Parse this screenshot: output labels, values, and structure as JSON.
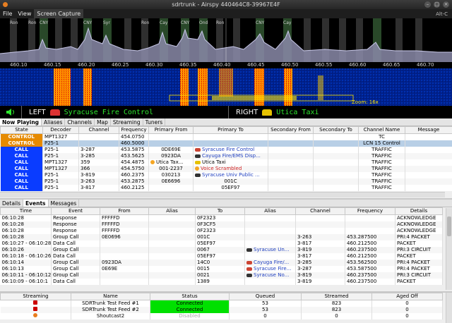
{
  "window": {
    "title": "sdrtrunk - Airspy 440464C8-39967E4F"
  },
  "menu": {
    "items": [
      "File",
      "View",
      "Screen Capture"
    ],
    "shortcut": "Alt-C"
  },
  "spectrum": {
    "labels": [
      {
        "text": "Ron"
      },
      {
        "text": "Ron"
      },
      {
        "text": "Ron"
      },
      {
        "text": "Ron"
      },
      {
        "text": "CNY"
      },
      {
        "text": "CNY"
      },
      {
        "text": "CNY"
      },
      {
        "text": "CNY"
      },
      {
        "text": "Syr"
      },
      {
        "text": "Cay"
      },
      {
        "text": "Ond"
      },
      {
        "text": "Cay"
      }
    ]
  },
  "axis": {
    "ticks": [
      "460.10",
      "460.15",
      "460.20",
      "460.25",
      "460.30",
      "460.35",
      "460.40",
      "460.45",
      "460.50",
      "460.55",
      "460.60",
      "460.65",
      "460.70"
    ]
  },
  "waterfall": {
    "zoom_label": "Zoom: 16x"
  },
  "audio": {
    "left_label": "LEFT",
    "left_channel": "Syracuse Fire Control",
    "right_label": "RIGHT",
    "right_channel": "Utica Taxi"
  },
  "top_tabs": [
    "Now Playing",
    "Aliases",
    "Channels",
    "Map",
    "Streaming",
    "Tuners"
  ],
  "channels_table": {
    "headers": [
      "State",
      "Decoder",
      "Channel",
      "Frequency",
      "Primary From",
      "Primary To",
      "Secondary From",
      "Secondary To",
      "Channel Name",
      "Message"
    ],
    "rows": [
      {
        "state": "CONTROL",
        "decoder": "MPT1327",
        "channel": "",
        "freq": "454.0750",
        "pfrom": "",
        "pto": "",
        "sfrom": "",
        "sto": "",
        "name": "TC",
        "msg": ""
      },
      {
        "state": "CONTROL",
        "decoder": "P25-1",
        "channel": "",
        "freq": "460.5000",
        "pfrom": "",
        "pto": "",
        "sfrom": "",
        "sto": "",
        "name": "LCN 15 Control",
        "msg": ""
      },
      {
        "state": "CALL",
        "decoder": "P25-1",
        "channel": "3-287",
        "freq": "453.5875",
        "pfrom": "0DE69E",
        "pto": "Syracuse Fire Control",
        "sfrom": "",
        "sto": "",
        "name": "TRAFFIC",
        "msg": ""
      },
      {
        "state": "CALL",
        "decoder": "P25-1",
        "channel": "3-285",
        "freq": "453.5625",
        "pfrom": "0923DA",
        "pto": "Cayuga Fire/EMS Disp...",
        "sfrom": "",
        "sto": "",
        "name": "TRAFFIC",
        "msg": ""
      },
      {
        "state": "CALL",
        "decoder": "MPT1327",
        "channel": "359",
        "freq": "454.4875",
        "pfrom": "Utica Tax...",
        "pto": "Utica Taxi",
        "sfrom": "",
        "sto": "",
        "name": "TRAFFIC",
        "msg": ""
      },
      {
        "state": "CALL",
        "decoder": "MPT1327",
        "channel": "366",
        "freq": "454.5750",
        "pfrom": "001-2237",
        "pto": "Voice Scrambled",
        "sfrom": "",
        "sto": "",
        "name": "TRAFFIC",
        "msg": ""
      },
      {
        "state": "CALL",
        "decoder": "P25-1",
        "channel": "3-819",
        "freq": "460.2375",
        "pfrom": "030213",
        "pto": "Syracuse Univ Public ...",
        "sfrom": "",
        "sto": "",
        "name": "TRAFFIC",
        "msg": ""
      },
      {
        "state": "CALL",
        "decoder": "P25-1",
        "channel": "3-263",
        "freq": "453.2875",
        "pfrom": "0E6696",
        "pto": "001C",
        "sfrom": "",
        "sto": "",
        "name": "TRAFFIC",
        "msg": ""
      },
      {
        "state": "CALL",
        "decoder": "P25-1",
        "channel": "3-817",
        "freq": "460.2125",
        "pfrom": "",
        "pto": "05EF97",
        "sfrom": "",
        "sto": "",
        "name": "TRAFFIC",
        "msg": ""
      }
    ]
  },
  "bottom_tabs": [
    "Details",
    "Events",
    "Messages"
  ],
  "events_table": {
    "headers": [
      "Time",
      "Event",
      "From",
      "Alias",
      "To",
      "Alias",
      "Channel",
      "Frequency",
      "Details"
    ],
    "rows": [
      {
        "time": "06:10:28",
        "event": "Response",
        "from": "FFFFFD",
        "falias": "",
        "to": "0F2323",
        "talias": "",
        "ch": "",
        "freq": "",
        "details": "ACKNOWLEDGE"
      },
      {
        "time": "06:10:28",
        "event": "Response",
        "from": "FFFFFD",
        "falias": "",
        "to": "0F3CF5",
        "talias": "",
        "ch": "",
        "freq": "",
        "details": "ACKNOWLEDGE"
      },
      {
        "time": "06:10:28",
        "event": "Response",
        "from": "FFFFFD",
        "falias": "",
        "to": "0F2323",
        "talias": "",
        "ch": "",
        "freq": "",
        "details": "ACKNOWLEDGE"
      },
      {
        "time": "06:10:28",
        "event": "Group Call",
        "from": "0E0696",
        "falias": "",
        "to": "001C",
        "talias": "",
        "ch": "3-263",
        "freq": "453.287500",
        "details": "PRI:4 PACKET"
      },
      {
        "time": "06:10:27 - 06:10:28",
        "event": "Data Call",
        "from": "",
        "falias": "",
        "to": "05EF97",
        "talias": "",
        "ch": "3-817",
        "freq": "460.212500",
        "details": "PACKET"
      },
      {
        "time": "06:10:26",
        "event": "Group Call",
        "from": "",
        "falias": "",
        "to": "0067",
        "talias": "Syracuse Un...",
        "ch": "3-819",
        "freq": "460.237500",
        "details": "PRI:3 CIRCUIT"
      },
      {
        "time": "06:10:18 - 06:10:26",
        "event": "Data Call",
        "from": "",
        "falias": "",
        "to": "05EF97",
        "talias": "",
        "ch": "3-817",
        "freq": "460.212500",
        "details": "PACKET"
      },
      {
        "time": "06:10:14",
        "event": "Group Call",
        "from": "0923DA",
        "falias": "",
        "to": "14C0",
        "talias": "Cayuga Fire/...",
        "ch": "3-285",
        "freq": "453.562500",
        "details": "PRI:4 PACKET"
      },
      {
        "time": "06:10:13",
        "event": "Group Call",
        "from": "0E69E",
        "falias": "",
        "to": "0015",
        "talias": "Syracuse Fire...",
        "ch": "3-287",
        "freq": "453.587500",
        "details": "PRI:4 PACKET"
      },
      {
        "time": "06:10:11 - 06:10:12",
        "event": "Group Call",
        "from": "",
        "falias": "",
        "to": "0021",
        "talias": "Syracuse No...",
        "ch": "3-819",
        "freq": "460.237500",
        "details": "PRI:3 CIRCUIT"
      },
      {
        "time": "06:10:09 - 06:10:1",
        "event": "Data Call",
        "from": "",
        "falias": "",
        "to": "1389",
        "talias": "",
        "ch": "3-819",
        "freq": "460.237500",
        "details": "PACKET"
      }
    ]
  },
  "stream_table": {
    "headers": [
      "Streaming",
      "Name",
      "Status",
      "Queued",
      "Streamed",
      "Aged Off"
    ],
    "rows": [
      {
        "name": "SDRTrunk Test Feed #1",
        "status": "Connected",
        "queued": "53",
        "streamed": "823",
        "aged": "0"
      },
      {
        "name": "SDRTrunk Test Feed #2",
        "status": "Connected",
        "queued": "53",
        "streamed": "823",
        "aged": "0"
      },
      {
        "name": "Shoutcast2",
        "status": "Disabled",
        "queued": "0",
        "streamed": "0",
        "aged": "0"
      }
    ]
  }
}
